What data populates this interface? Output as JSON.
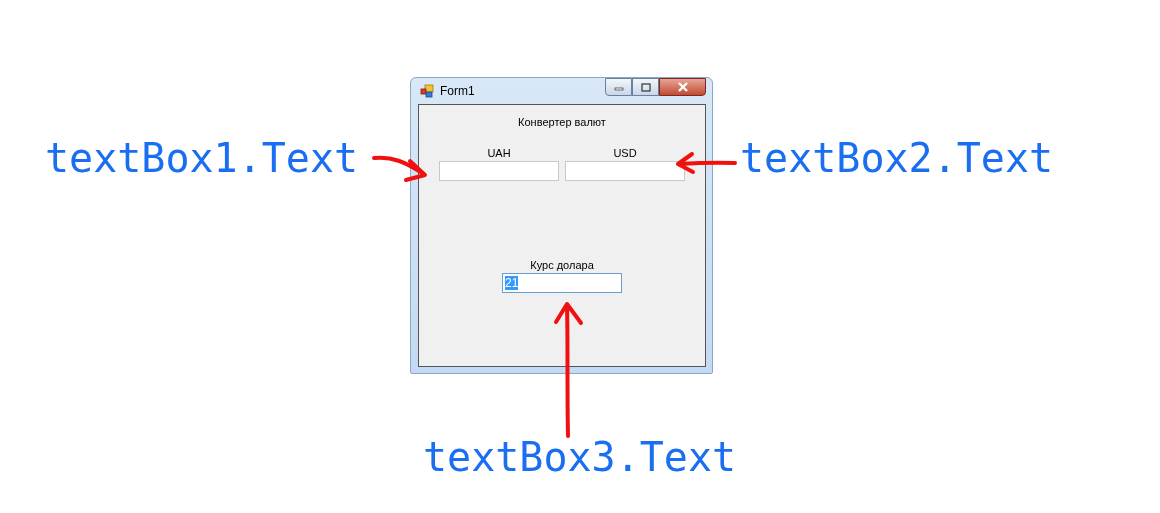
{
  "window": {
    "title": "Form1"
  },
  "form": {
    "heading": "Конвертер валют",
    "fields": [
      {
        "label": "UAH",
        "focused": false
      },
      {
        "label": "USD",
        "focused": false
      },
      {
        "label": "Курс долара",
        "value": "21",
        "focused": true
      }
    ]
  },
  "annotations": [
    {
      "text": "textBox1.Text"
    },
    {
      "text": "textBox2.Text"
    },
    {
      "text": "textBox3.Text"
    }
  ]
}
